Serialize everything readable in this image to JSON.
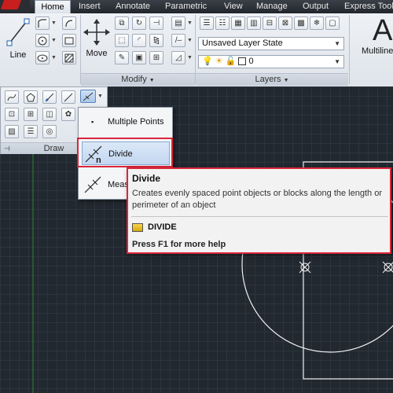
{
  "tabs": [
    {
      "label": "Home",
      "active": true
    },
    {
      "label": "Insert"
    },
    {
      "label": "Annotate"
    },
    {
      "label": "Parametric"
    },
    {
      "label": "View"
    },
    {
      "label": "Manage"
    },
    {
      "label": "Output"
    },
    {
      "label": "Express Tools"
    }
  ],
  "ribbon": {
    "line_label": "Line",
    "move_label": "Move",
    "multiline_label": "Multiline",
    "big_letter": "A",
    "modify_title": "Modify",
    "layers_title": "Layers",
    "layer_state": "Unsaved Layer State",
    "layer_current": "0"
  },
  "draw_panel": {
    "title": "Draw"
  },
  "flyout": {
    "items": [
      {
        "label": "Multiple Points"
      },
      {
        "label": "Divide"
      },
      {
        "label": "Measure"
      }
    ]
  },
  "tooltip": {
    "title": "Divide",
    "description": "Creates evenly spaced point objects or blocks along the length or perimeter of an object",
    "command": "DIVIDE",
    "help": "Press F1 for more help"
  },
  "colors": {
    "canvas": "#212830",
    "highlight_frame": "#d8263a",
    "accent_red": "#c81e1e"
  }
}
